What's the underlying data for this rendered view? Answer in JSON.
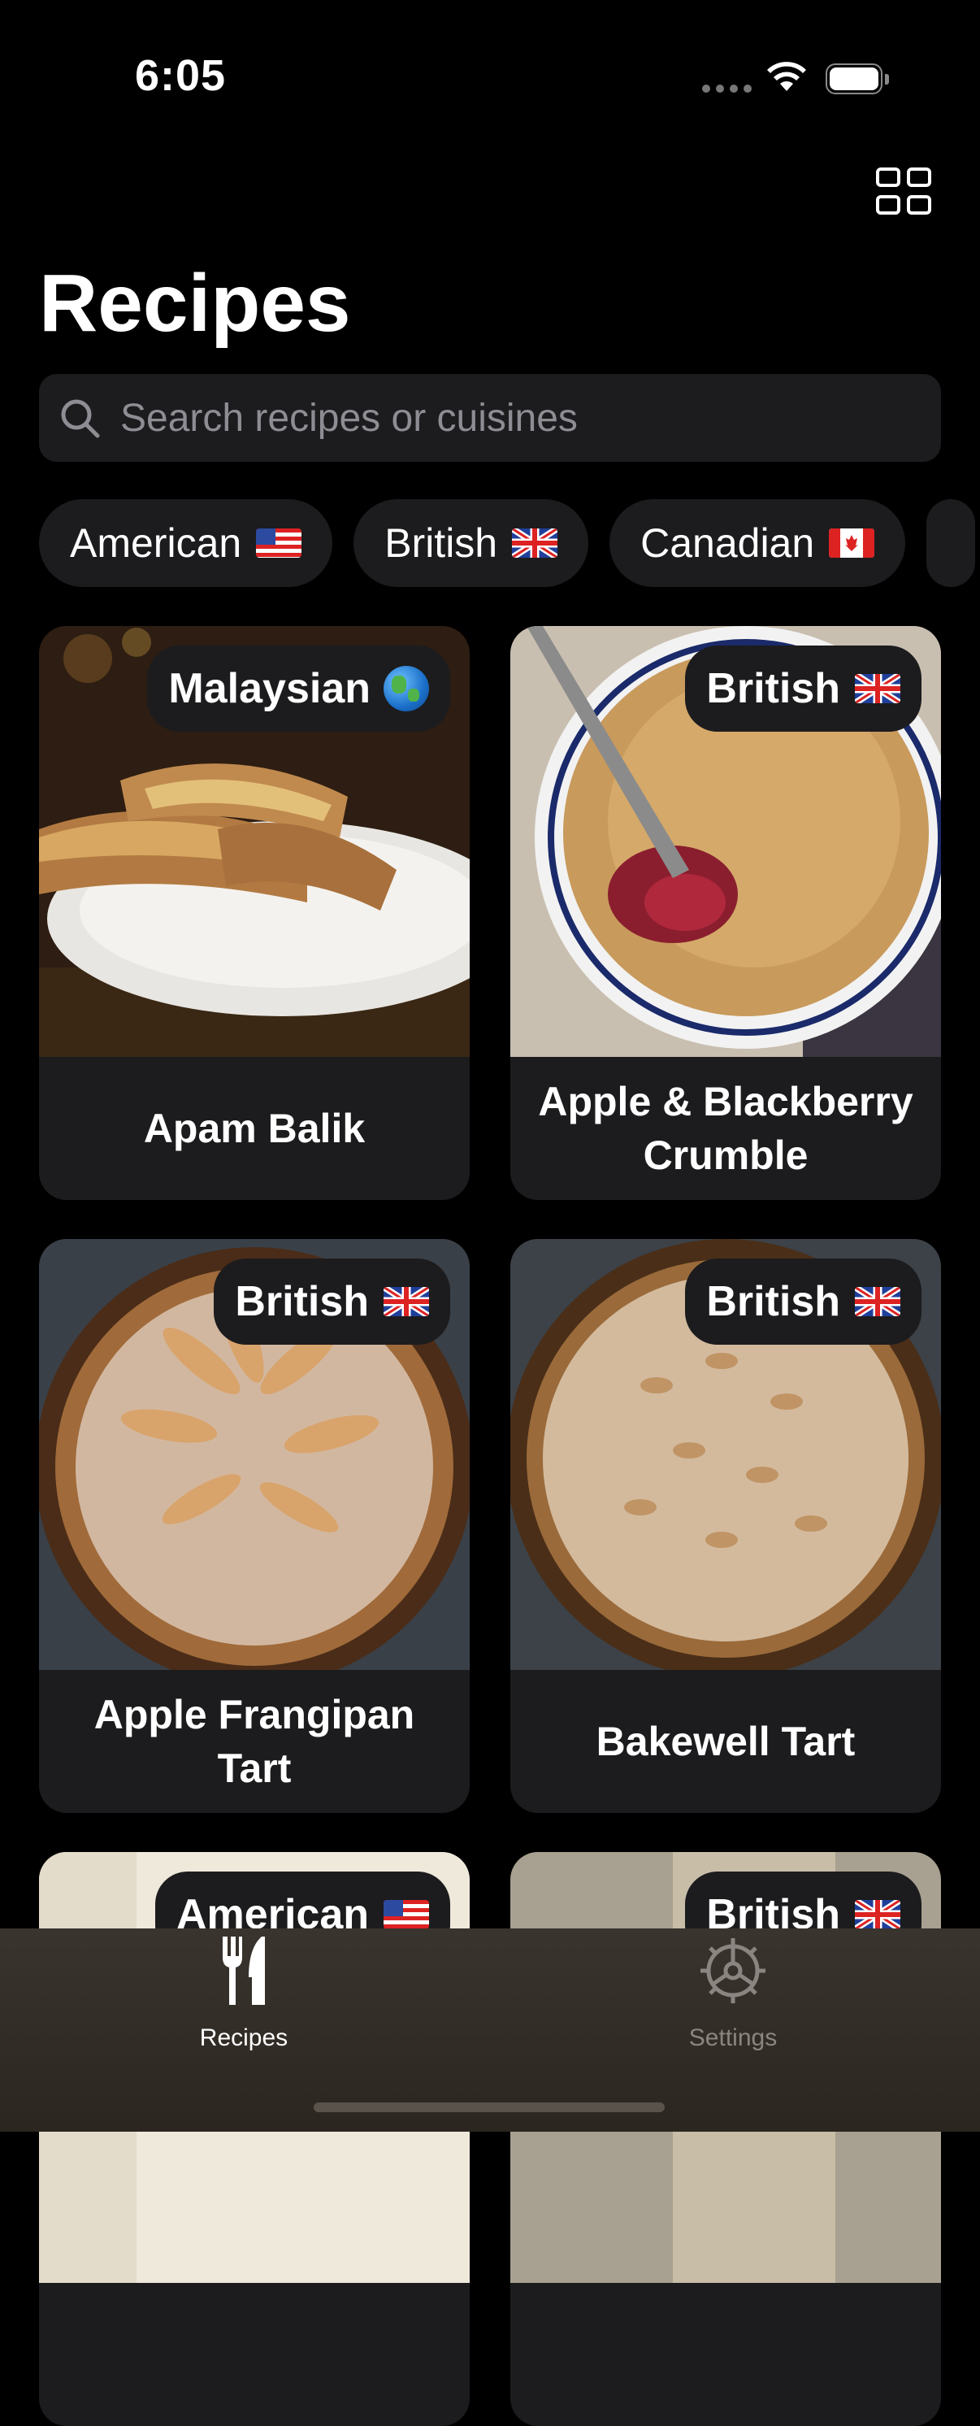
{
  "status_bar": {
    "time": "6:05"
  },
  "header": {
    "title": "Recipes"
  },
  "search": {
    "placeholder": "Search recipes or cuisines",
    "value": ""
  },
  "filters": [
    {
      "label": "American",
      "flag": "us"
    },
    {
      "label": "British",
      "flag": "gb"
    },
    {
      "label": "Canadian",
      "flag": "ca"
    }
  ],
  "recipes": [
    {
      "name": "Apam Balik",
      "cuisine": "Malaysian",
      "flag": "globe-icon"
    },
    {
      "name": "Apple & Blackberry Crumble",
      "cuisine": "British",
      "flag": "gb"
    },
    {
      "name": "Apple Frangipan Tart",
      "cuisine": "British",
      "flag": "gb"
    },
    {
      "name": "Bakewell Tart",
      "cuisine": "British",
      "flag": "gb"
    },
    {
      "name": "",
      "cuisine": "American",
      "flag": "us"
    },
    {
      "name": "",
      "cuisine": "British",
      "flag": "gb"
    }
  ],
  "tabs": [
    {
      "label": "Recipes",
      "icon": "fork-knife-icon",
      "active": true
    },
    {
      "label": "Settings",
      "icon": "gear-icon",
      "active": false
    }
  ],
  "colors": {
    "background": "#000000",
    "card": "#1c1c1e",
    "placeholder": "#8d8d93",
    "inactive_tab": "#8a8580"
  }
}
